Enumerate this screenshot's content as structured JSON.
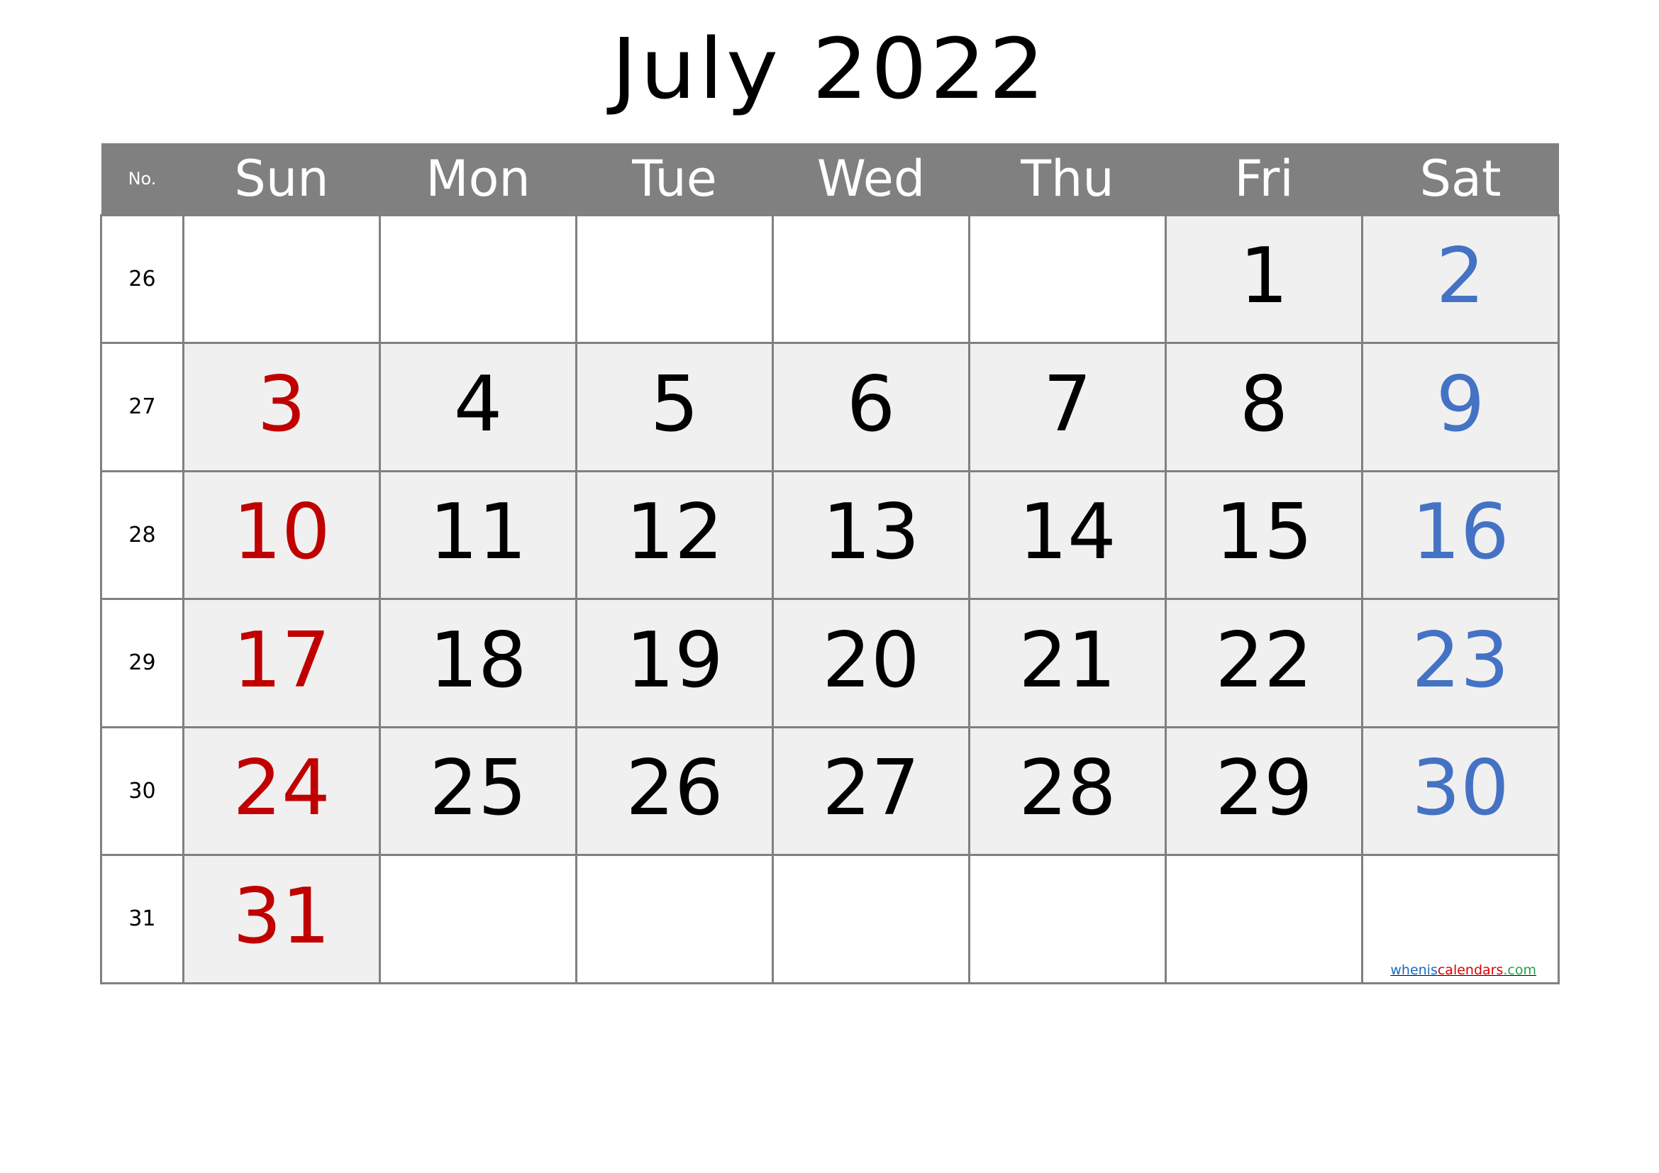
{
  "title": "July 2022",
  "header": {
    "week_col": "No.",
    "days": [
      "Sun",
      "Mon",
      "Tue",
      "Wed",
      "Thu",
      "Fri",
      "Sat"
    ]
  },
  "colors": {
    "header_bg": "#808080",
    "grid": "#808080",
    "in_month_fill": "#f0f0f0",
    "sunday": "#c00000",
    "saturday": "#4472c4",
    "weekday": "#000000"
  },
  "weeks": [
    {
      "no": "26",
      "days": [
        "",
        "",
        "",
        "",
        "",
        "1",
        "2"
      ]
    },
    {
      "no": "27",
      "days": [
        "3",
        "4",
        "5",
        "6",
        "7",
        "8",
        "9"
      ]
    },
    {
      "no": "28",
      "days": [
        "10",
        "11",
        "12",
        "13",
        "14",
        "15",
        "16"
      ]
    },
    {
      "no": "29",
      "days": [
        "17",
        "18",
        "19",
        "20",
        "21",
        "22",
        "23"
      ]
    },
    {
      "no": "30",
      "days": [
        "24",
        "25",
        "26",
        "27",
        "28",
        "29",
        "30"
      ]
    },
    {
      "no": "31",
      "days": [
        "31",
        "",
        "",
        "",
        "",
        "",
        ""
      ]
    }
  ],
  "watermark": {
    "part1": "whenis",
    "part2": "calendars",
    "part3": ".com"
  }
}
